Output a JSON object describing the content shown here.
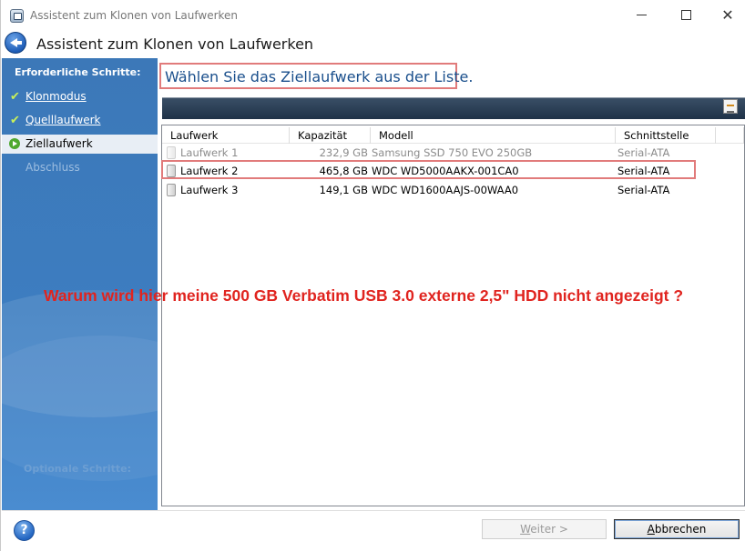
{
  "window": {
    "title": "Assistent zum Klonen von Laufwerken",
    "controls": {
      "minimize": "—",
      "maximize": "□",
      "close": "✕"
    }
  },
  "header": {
    "title": "Assistent zum Klonen von Laufwerken"
  },
  "sidebar": {
    "heading": "Erforderliche Schritte:",
    "steps": [
      {
        "label": "Klonmodus",
        "state": "done"
      },
      {
        "label": "Quelllaufwerk",
        "state": "done"
      },
      {
        "label": "Ziellaufwerk",
        "state": "current"
      },
      {
        "label": "Abschluss",
        "state": "pending"
      }
    ],
    "optional_heading": "Optionale Schritte:"
  },
  "main": {
    "instruction": "Wählen Sie das Ziellaufwerk aus der Liste.",
    "columns": [
      "Laufwerk",
      "Kapazität",
      "Modell",
      "Schnittstelle",
      ""
    ],
    "rows": [
      {
        "drive": "Laufwerk 1",
        "capacity": "232,9 GB",
        "model": "Samsung SSD 750 EVO 250GB",
        "interface": "Serial-ATA",
        "enabled": false
      },
      {
        "drive": "Laufwerk 2",
        "capacity": "465,8 GB",
        "model": "WDC WD5000AAKX-001CA0",
        "interface": "Serial-ATA",
        "enabled": true
      },
      {
        "drive": "Laufwerk 3",
        "capacity": "149,1 GB",
        "model": "WDC WD1600AAJS-00WAA0",
        "interface": "Serial-ATA",
        "enabled": true
      }
    ]
  },
  "annotation": {
    "text": "Warum wird hier meine 500 GB Verbatim USB 3.0 externe 2,5\" HDD nicht angezeigt ?",
    "color": "#e0241f"
  },
  "footer": {
    "help": "?",
    "next_accel": "W",
    "next_rest": "eiter >",
    "cancel_accel": "A",
    "cancel_rest": "bbrechen"
  },
  "colors": {
    "sidebar": "#3d7dc0",
    "highlight_box": "#e17b7b",
    "instruction_text": "#1a4f8c"
  }
}
